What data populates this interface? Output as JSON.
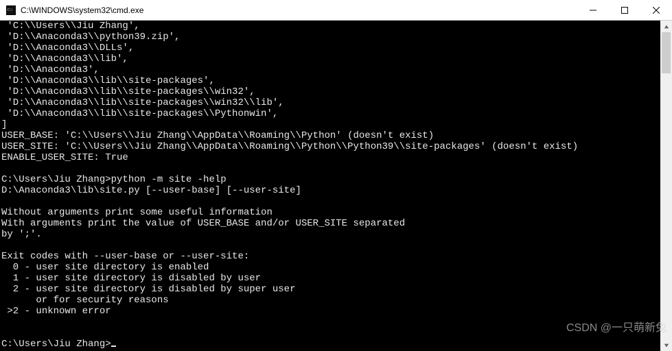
{
  "window": {
    "title": "C:\\WINDOWS\\system32\\cmd.exe"
  },
  "terminal": {
    "lines": [
      " 'C:\\\\Users\\\\Jiu Zhang',",
      " 'D:\\\\Anaconda3\\\\python39.zip',",
      " 'D:\\\\Anaconda3\\\\DLLs',",
      " 'D:\\\\Anaconda3\\\\lib',",
      " 'D:\\\\Anaconda3',",
      " 'D:\\\\Anaconda3\\\\lib\\\\site-packages',",
      " 'D:\\\\Anaconda3\\\\lib\\\\site-packages\\\\win32',",
      " 'D:\\\\Anaconda3\\\\lib\\\\site-packages\\\\win32\\\\lib',",
      " 'D:\\\\Anaconda3\\\\lib\\\\site-packages\\\\Pythonwin',",
      "]",
      "USER_BASE: 'C:\\\\Users\\\\Jiu Zhang\\\\AppData\\\\Roaming\\\\Python' (doesn't exist)",
      "USER_SITE: 'C:\\\\Users\\\\Jiu Zhang\\\\AppData\\\\Roaming\\\\Python\\\\Python39\\\\site-packages' (doesn't exist)",
      "ENABLE_USER_SITE: True",
      "",
      "C:\\Users\\Jiu Zhang>python -m site -help",
      "D:\\Anaconda3\\lib\\site.py [--user-base] [--user-site]",
      "",
      "Without arguments print some useful information",
      "With arguments print the value of USER_BASE and/or USER_SITE separated",
      "by ';'.",
      "",
      "Exit codes with --user-base or --user-site:",
      "  0 - user site directory is enabled",
      "  1 - user site directory is disabled by user",
      "  2 - user site directory is disabled by super user",
      "      or for security reasons",
      " >2 - unknown error",
      "",
      "",
      "C:\\Users\\Jiu Zhang>"
    ],
    "prompt_has_cursor": true
  },
  "watermark": "CSDN @一只萌新兔"
}
